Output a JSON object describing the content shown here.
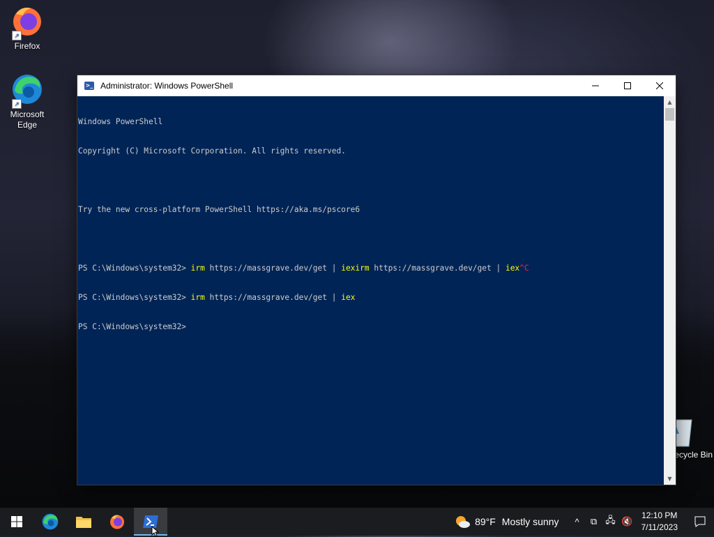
{
  "desktop": {
    "icons": [
      {
        "label": "Firefox"
      },
      {
        "label": "Microsoft\nEdge"
      },
      {
        "label": "Recycle Bin"
      }
    ]
  },
  "window": {
    "title": "Administrator: Windows PowerShell",
    "controls": {
      "minimize": "minimize-icon",
      "maximize": "maximize-icon",
      "close": "close-icon"
    }
  },
  "console": {
    "line1": "Windows PowerShell",
    "line2": "Copyright (C) Microsoft Corporation. All rights reserved.",
    "line3": "",
    "line4": "Try the new cross-platform PowerShell https://aka.ms/pscore6",
    "line5": "",
    "prompt": "PS C:\\Windows\\system32> ",
    "cmd1": {
      "p1": "irm",
      "p2": " https://massgrave.dev/get | ",
      "p3": "iexirm",
      "p4": " https://massgrave.dev/get | ",
      "p5": "iex",
      "p6": "^C"
    },
    "cmd2": {
      "p1": "irm",
      "p2": " https://massgrave.dev/get | ",
      "p3": "iex"
    },
    "colors": {
      "background": "#012456",
      "text": "#cccccc",
      "command": "#ffff00",
      "interrupt": "#ff1e3c"
    }
  },
  "taskbar": {
    "apps": [
      "windows-start-icon",
      "edge-icon",
      "file-explorer-icon",
      "firefox-icon",
      "powershell-icon"
    ],
    "weather": {
      "temp": "89°F",
      "condition": "Mostly sunny"
    },
    "clock": {
      "time": "12:10 PM",
      "date": "7/11/2023"
    }
  }
}
